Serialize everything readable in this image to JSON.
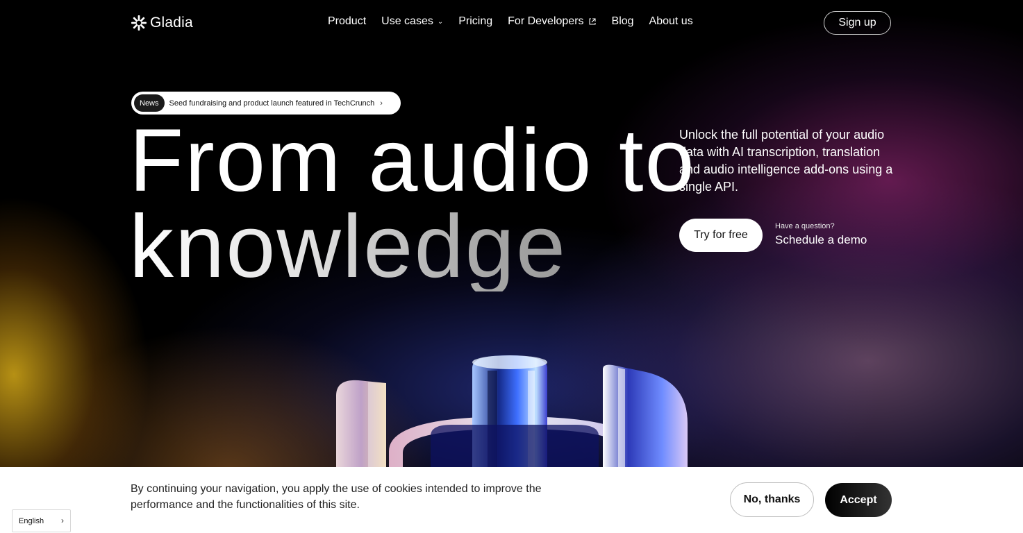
{
  "brand": {
    "name": "Gladia",
    "logo_icon": "gladia-burst-icon"
  },
  "nav": {
    "items": [
      {
        "label": "Product",
        "icon": ""
      },
      {
        "label": "Use cases",
        "icon": "chevron-down-icon"
      },
      {
        "label": "Pricing",
        "icon": ""
      },
      {
        "label": "For Developers",
        "icon": "external-link-icon"
      },
      {
        "label": "Blog",
        "icon": ""
      },
      {
        "label": "About us",
        "icon": ""
      }
    ],
    "signup_label": "Sign up"
  },
  "news": {
    "badge": "News",
    "text": "Seed fundraising and product launch featured in TechCrunch"
  },
  "hero": {
    "line1": "From audio to",
    "line2": "knowledge",
    "subtitle": "Unlock the full potential of your audio data with AI transcription, translation and audio intelligence add-ons using a single API.",
    "cta_label": "Try for free",
    "question": "Have a question?",
    "demo_label": "Schedule a demo"
  },
  "cookie": {
    "text": "By continuing your navigation, you apply the use of cookies intended to improve the performance and the functionalities of this site.",
    "decline_label": "No, thanks",
    "accept_label": "Accept"
  },
  "language": {
    "selected": "English"
  },
  "colors": {
    "background": "#000000",
    "button_light": "#ffffff",
    "accent_purple": "#962878",
    "accent_gold": "#d6aa18",
    "accent_blue": "#28328c"
  }
}
